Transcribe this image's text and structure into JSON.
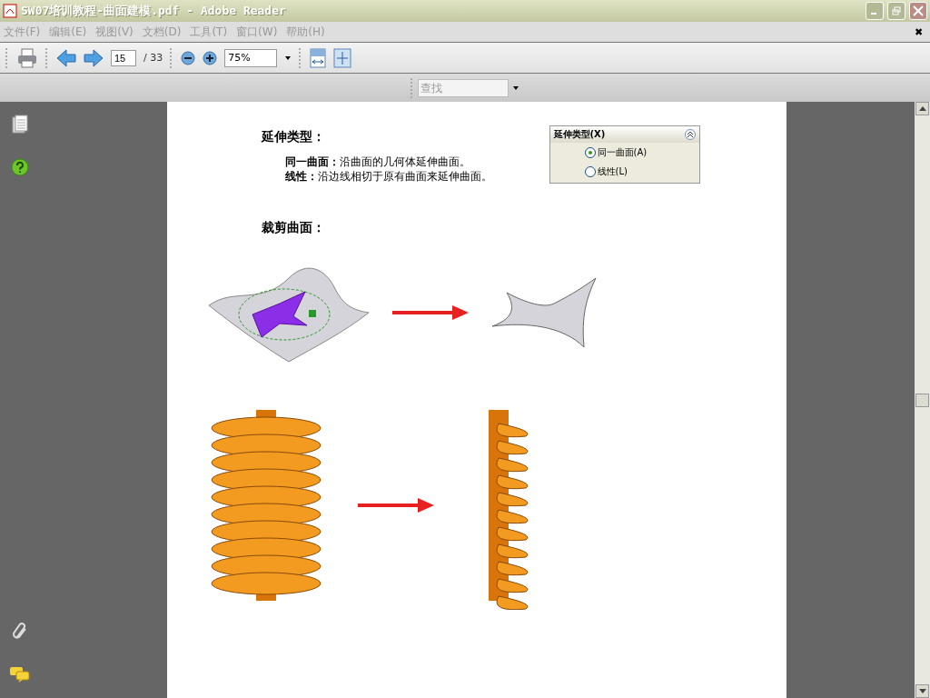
{
  "window": {
    "title": "SW07培训教程-曲面建模.pdf - Adobe Reader"
  },
  "menu": [
    "文件(F)",
    "编辑(E)",
    "视图(V)",
    "文档(D)",
    "工具(T)",
    "窗口(W)",
    "帮助(H)"
  ],
  "menu_close": "✖",
  "toolbar": {
    "page": "15",
    "total": "/ 33",
    "zoom": "75%"
  },
  "find": {
    "placeholder": "查找"
  },
  "page": {
    "heading_1": "延伸类型：",
    "lines": [
      "**同一曲面：**沿曲面的几何体延伸曲面。",
      "**线性：**沿边线相切于原有曲面来延伸曲面。"
    ],
    "dialog": {
      "title": "延伸类型(X)",
      "options": [
        {
          "label": "同一曲面(A)",
          "selected": true
        },
        {
          "label": "线性(L)",
          "selected": false
        }
      ]
    },
    "heading_2": "裁剪曲面："
  }
}
